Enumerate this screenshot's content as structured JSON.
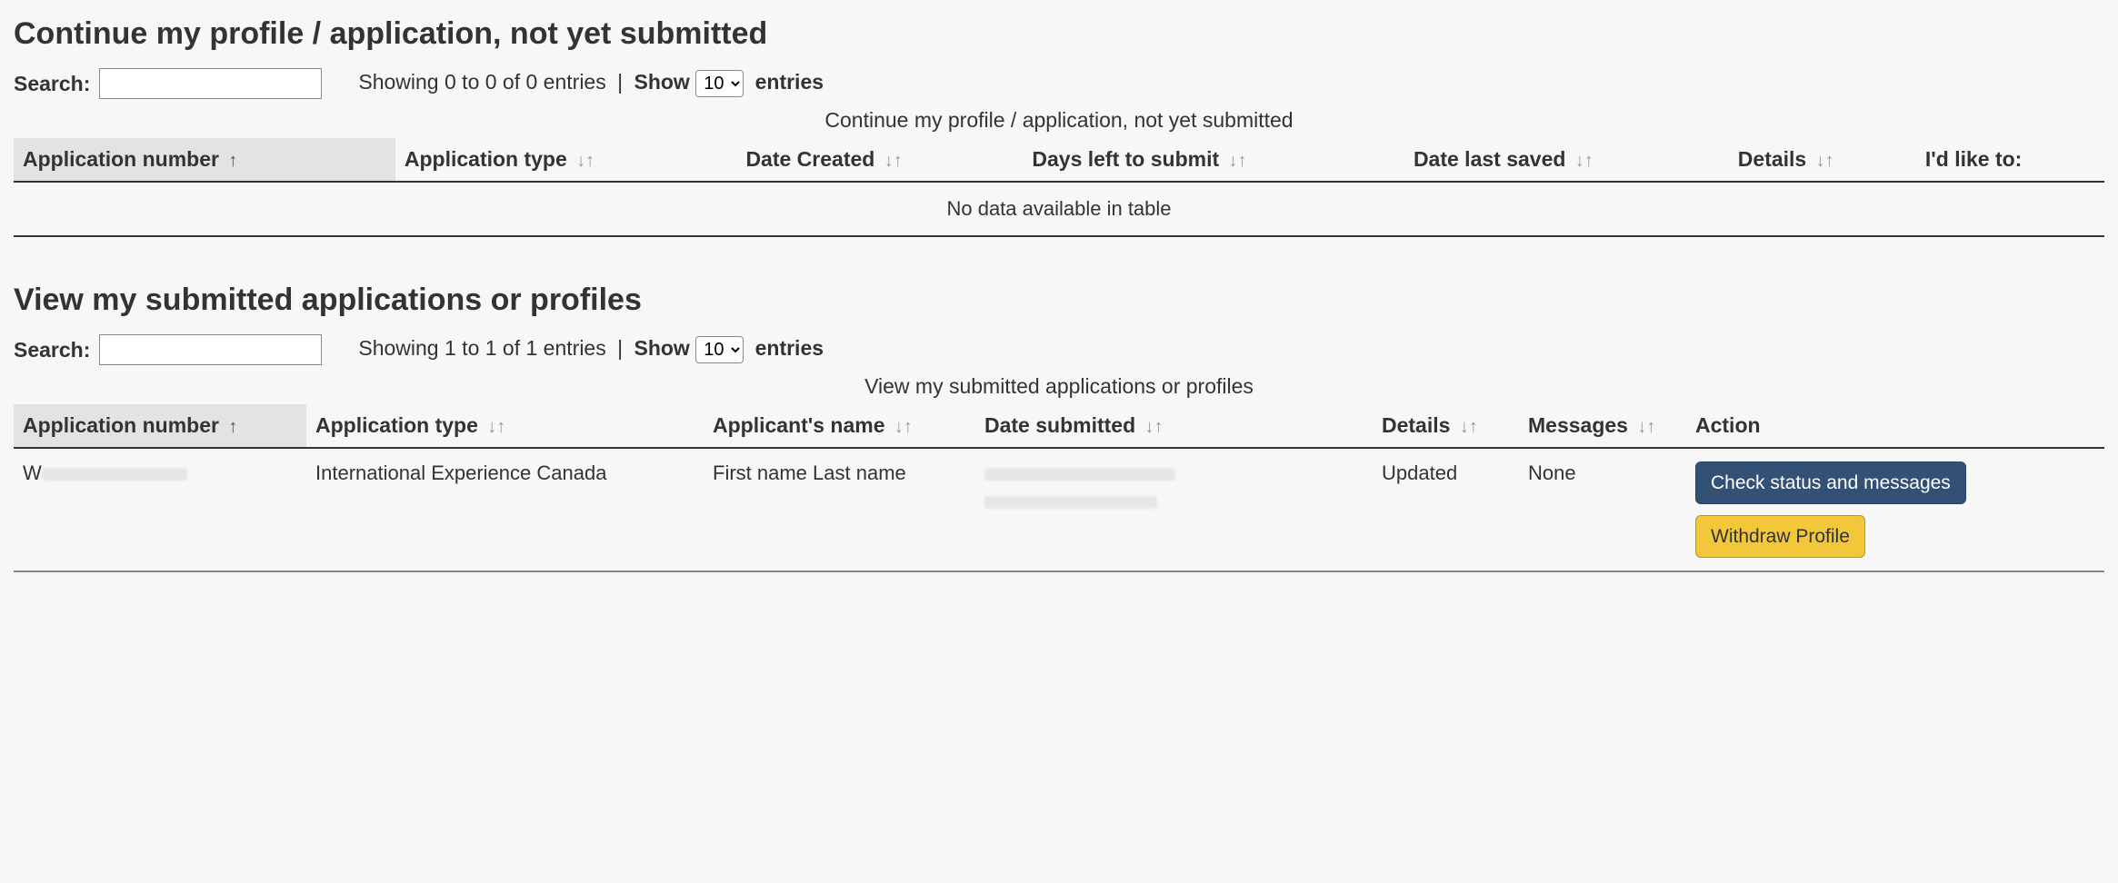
{
  "section1": {
    "title": "Continue my profile / application, not yet submitted",
    "search_label": "Search:",
    "showing_text": "Showing 0 to 0 of 0 entries",
    "show_label": "Show",
    "entries_value": "10",
    "entries_suffix": "entries",
    "caption": "Continue my profile / application, not yet submitted",
    "columns": {
      "app_number": "Application number",
      "app_type": "Application type",
      "date_created": "Date Created",
      "days_left": "Days left to submit",
      "date_saved": "Date last saved",
      "details": "Details",
      "like_to": "I'd like to:"
    },
    "empty_text": "No data available in table"
  },
  "section2": {
    "title": "View my submitted applications or profiles",
    "search_label": "Search:",
    "showing_text": "Showing 1 to 1 of 1 entries",
    "show_label": "Show",
    "entries_value": "10",
    "entries_suffix": "entries",
    "caption": "View my submitted applications or profiles",
    "columns": {
      "app_number": "Application number",
      "app_type": "Application type",
      "applicant_name": "Applicant's name",
      "date_submitted": "Date submitted",
      "details": "Details",
      "messages": "Messages",
      "action": "Action"
    },
    "row": {
      "app_number_prefix": "W",
      "app_type": "International Experience Canada",
      "applicant_name": "First name Last name",
      "details": "Updated",
      "messages": "None",
      "btn_check": "Check status and messages",
      "btn_withdraw": "Withdraw Profile"
    }
  }
}
